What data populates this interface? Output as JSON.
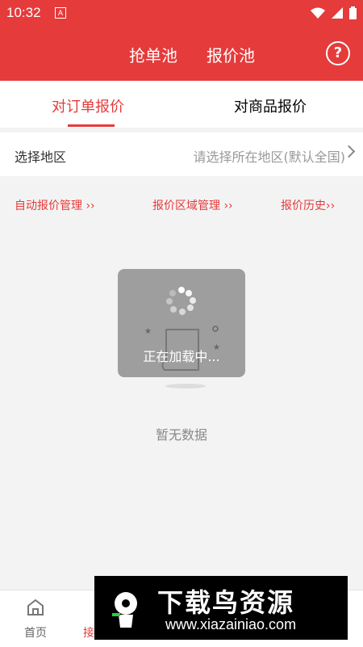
{
  "status": {
    "time": "10:32",
    "a_icon": "A"
  },
  "header": {
    "tabs": [
      "抢单池",
      "报价池"
    ],
    "help": "?"
  },
  "tabs": {
    "left": "对订单报价",
    "right": "对商品报价"
  },
  "region": {
    "label": "选择地区",
    "value": "请选择所在地区(默认全国)"
  },
  "links": {
    "auto": "自动报价管理 ››",
    "area": "报价区域管理 ››",
    "history": "报价历史››"
  },
  "loading": {
    "text": "正在加载中..."
  },
  "empty": {
    "text": "暂无数据"
  },
  "bottom_nav": {
    "home": "首页",
    "second": "接"
  },
  "watermark": {
    "title": "下载鸟资源",
    "url": "www.xiazainiao.com"
  }
}
